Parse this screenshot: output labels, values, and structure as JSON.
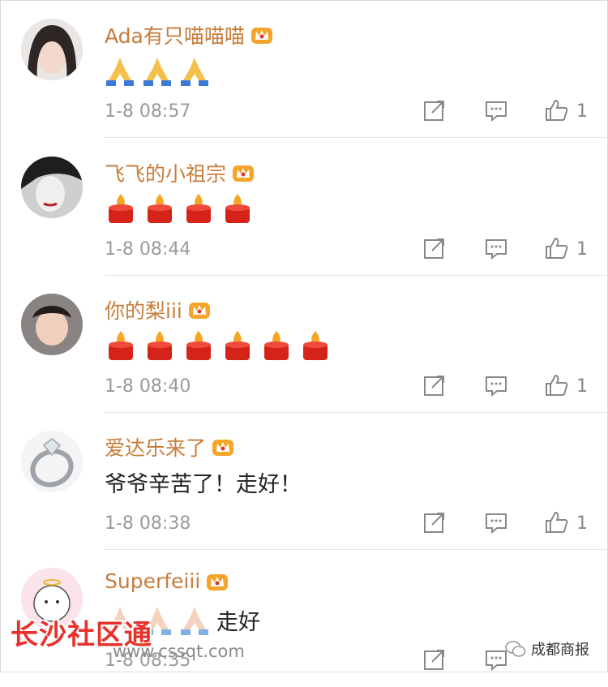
{
  "comments": [
    {
      "username": "Ada有只喵喵喵",
      "time": "1-8 08:57",
      "likes": "1",
      "content": "",
      "emoji": "folded-hands",
      "emoji_count": 3
    },
    {
      "username": "飞飞的小祖宗",
      "time": "1-8 08:44",
      "likes": "1",
      "content": "",
      "emoji": "candle",
      "emoji_count": 4
    },
    {
      "username": "你的梨iii",
      "time": "1-8 08:40",
      "likes": "1",
      "content": "",
      "emoji": "candle",
      "emoji_count": 6
    },
    {
      "username": "爱达乐来了",
      "time": "1-8 08:38",
      "likes": "1",
      "content": "爷爷辛苦了！走好！",
      "emoji": "",
      "emoji_count": 0
    },
    {
      "username": "Superfeiii",
      "time": "1-8 08:35",
      "likes": "",
      "content": "走好",
      "emoji": "folded-hands",
      "emoji_count": 3
    }
  ],
  "watermark": {
    "site": "长沙社区通",
    "url": "www.cssqt.com"
  },
  "brand": {
    "name": "成都商报"
  },
  "colors": {
    "username": "#c87d3a",
    "timestamp": "#9a9a9a",
    "watermark": "#e8312a"
  },
  "icons": {
    "share": "share-icon",
    "reply": "comment-icon",
    "like": "thumbs-up-icon",
    "badge": "crown-icon"
  }
}
